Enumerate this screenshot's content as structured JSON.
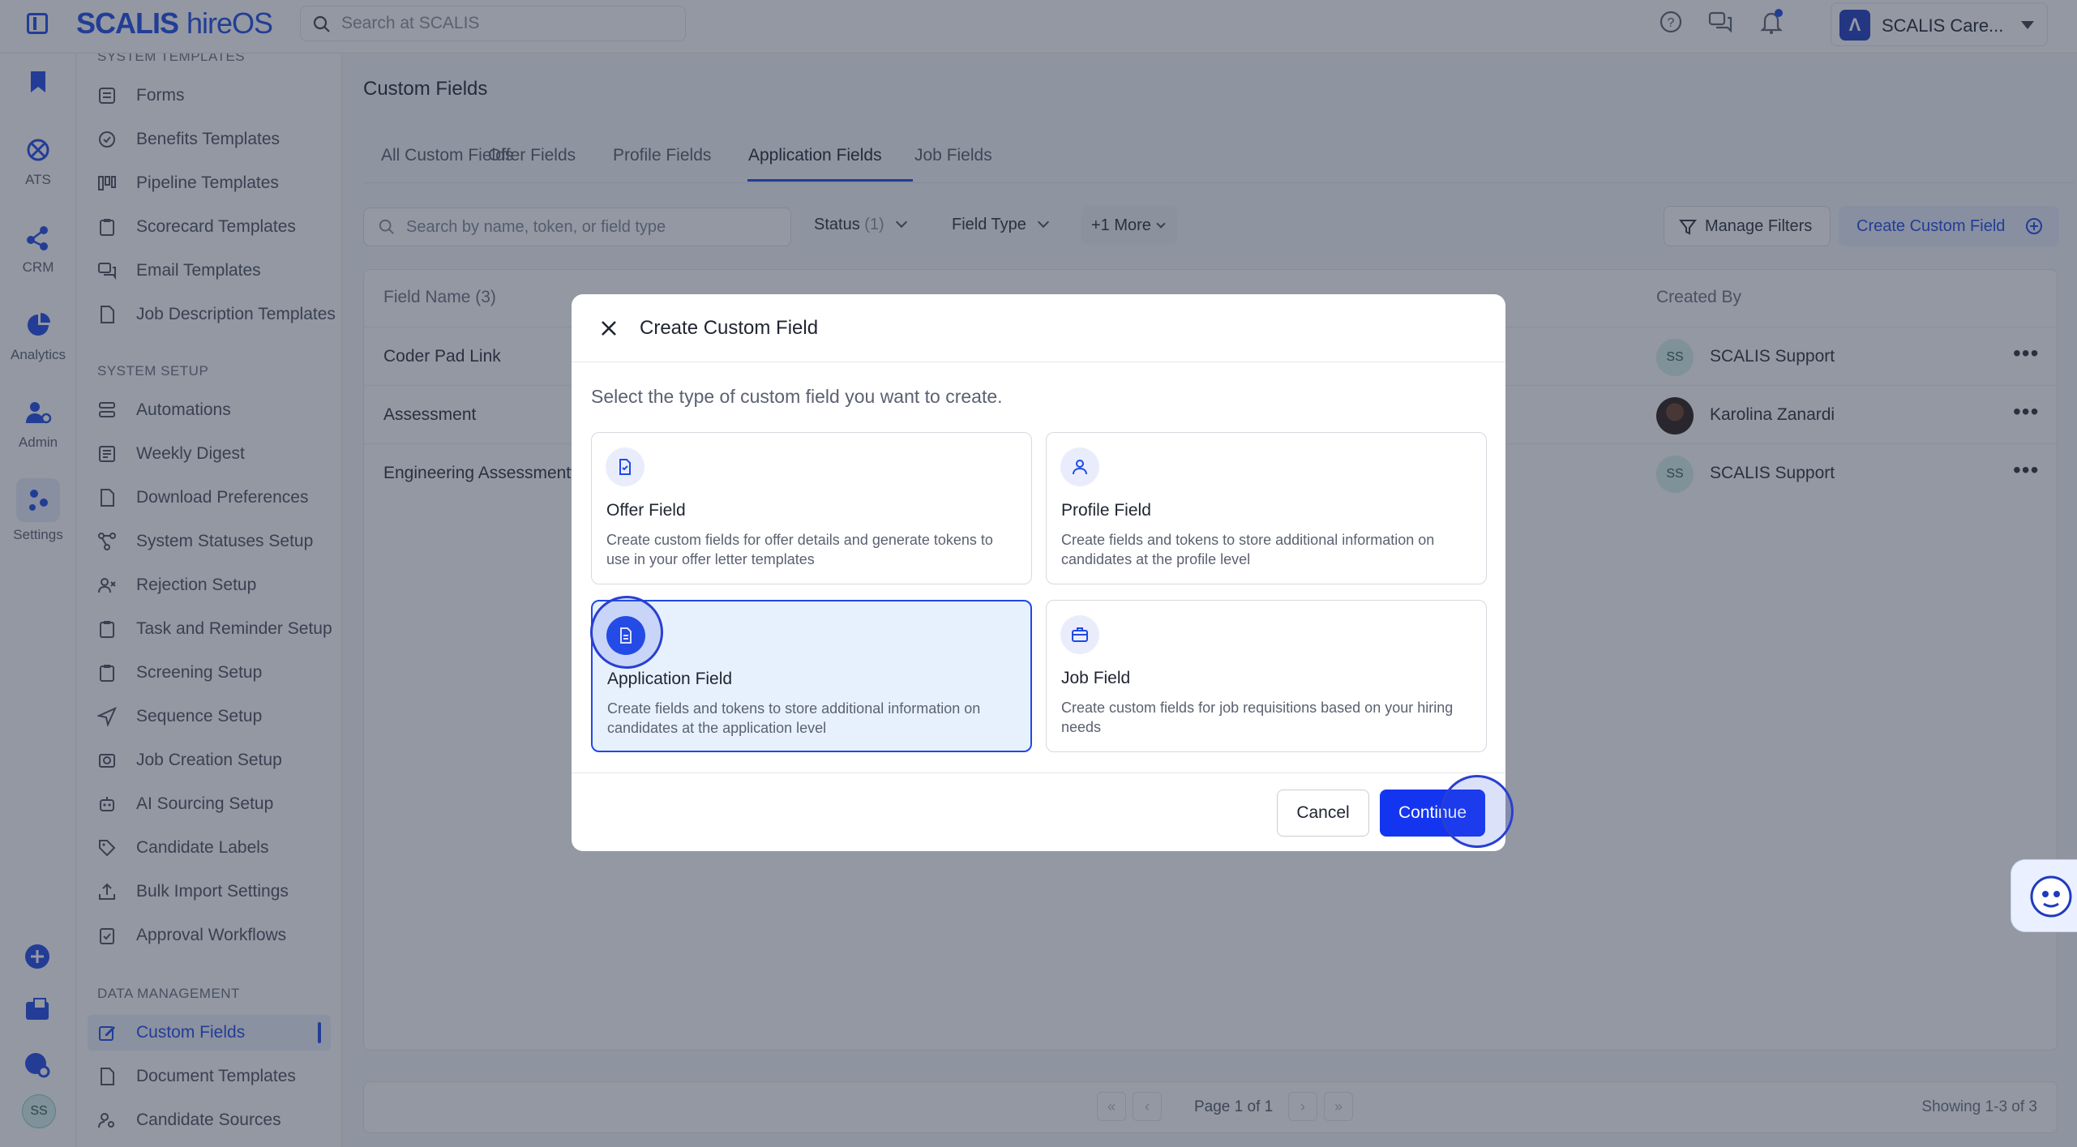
{
  "app": {
    "brand": "SCALIS",
    "product": "hireOS",
    "search_placeholder": "Search at SCALIS",
    "org_name": "SCALIS Care...",
    "org_initial": "Λ"
  },
  "rail": [
    {
      "label": "",
      "icon": "bookmark-icon"
    },
    {
      "label": "ATS",
      "icon": "ats-icon"
    },
    {
      "label": "CRM",
      "icon": "crm-icon"
    },
    {
      "label": "Analytics",
      "icon": "analytics-icon"
    },
    {
      "label": "Admin",
      "icon": "admin-icon"
    },
    {
      "label": "Settings",
      "icon": "settings-icon"
    }
  ],
  "user_initials": "SS",
  "sidebar": {
    "section_system_templates": "SYSTEM TEMPLATES",
    "templates": [
      "Forms",
      "Benefits Templates",
      "Pipeline Templates",
      "Scorecard Templates",
      "Email Templates",
      "Job Description Templates"
    ],
    "section_system_setup": "SYSTEM SETUP",
    "setup": [
      "Automations",
      "Weekly Digest",
      "Download Preferences",
      "System Statuses Setup",
      "Rejection Setup",
      "Task and Reminder Setup",
      "Screening Setup",
      "Sequence Setup",
      "Job Creation Setup",
      "AI Sourcing Setup",
      "Candidate Labels",
      "Bulk Import Settings",
      "Approval Workflows"
    ],
    "section_data_management": "DATA MANAGEMENT",
    "data": [
      "Custom Fields",
      "Document Templates",
      "Candidate Sources"
    ]
  },
  "page": {
    "title": "Custom Fields",
    "tabs": [
      "All Custom Fields",
      "Offer Fields",
      "Profile Fields",
      "Application Fields",
      "Job Fields"
    ],
    "active_tab": "Application Fields",
    "search_placeholder": "Search by name, token, or field type",
    "filters": {
      "status_label": "Status",
      "status_count": "(1)",
      "field_type_label": "Field Type",
      "more_label": "+1 More"
    },
    "manage_filters": "Manage Filters",
    "create_button": "Create Custom Field"
  },
  "table": {
    "headers": {
      "field_name": "Field Name (3)",
      "created_by": "Created By"
    },
    "rows": [
      {
        "field_name": "Coder Pad Link",
        "initials": "SS",
        "created_by": "SCALIS Support"
      },
      {
        "field_name": "Assessment",
        "initials": "",
        "created_by": "Karolina Zanardi"
      },
      {
        "field_name": "Engineering Assessmentv",
        "initials": "SS",
        "created_by": "SCALIS Support"
      }
    ]
  },
  "pagination": {
    "page_info": "Page 1 of 1",
    "showing": "Showing 1-3 of 3"
  },
  "modal": {
    "title": "Create Custom Field",
    "description": "Select the type of custom field you want to create.",
    "options": [
      {
        "title": "Offer Field",
        "desc": "Create custom fields for offer details and generate tokens to use in your offer letter templates",
        "icon": "document-icon"
      },
      {
        "title": "Profile Field",
        "desc": "Create fields and tokens to store additional information on candidates at the profile level",
        "icon": "person-icon"
      },
      {
        "title": "Application Field",
        "desc": "Create fields and tokens to store additional information on candidates at the application level",
        "icon": "file-icon"
      },
      {
        "title": "Job Field",
        "desc": "Create custom fields for job requisitions based on your hiring needs",
        "icon": "briefcase-icon"
      }
    ],
    "selected": "Application Field",
    "cancel": "Cancel",
    "continue": "Continue"
  },
  "colors": {
    "accent": "#1f49e6",
    "button_primary": "#1435f0",
    "selected_card": "#e7f1fd"
  }
}
